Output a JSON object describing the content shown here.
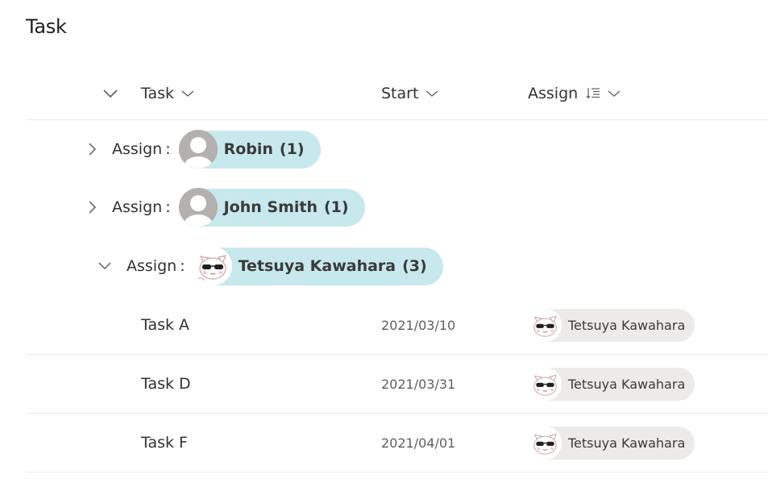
{
  "page": {
    "title": "Task"
  },
  "columns": {
    "task": "Task",
    "start": "Start",
    "assign": "Assign"
  },
  "groups": [
    {
      "label": "Assign",
      "separator": ":",
      "name": "Robin",
      "count": "(1)",
      "expanded": false,
      "avatar": "default-person-icon"
    },
    {
      "label": "Assign",
      "separator": ":",
      "name": "John Smith",
      "count": "(1)",
      "expanded": false,
      "avatar": "default-person-icon"
    },
    {
      "label": "Assign",
      "separator": ":",
      "name": "Tetsuya Kawahara",
      "count": "(3)",
      "expanded": true,
      "avatar": "cat-sunglasses-avatar"
    }
  ],
  "rows": [
    {
      "task": "Task A",
      "start": "2021/03/10",
      "assign": "Tetsuya Kawahara"
    },
    {
      "task": "Task D",
      "start": "2021/03/31",
      "assign": "Tetsuya Kawahara"
    },
    {
      "task": "Task F",
      "start": "2021/04/01",
      "assign": "Tetsuya Kawahara"
    }
  ],
  "colors": {
    "group_pill": "#c7e8ec",
    "user_chip": "#edebe9",
    "divider": "#edebe9"
  }
}
